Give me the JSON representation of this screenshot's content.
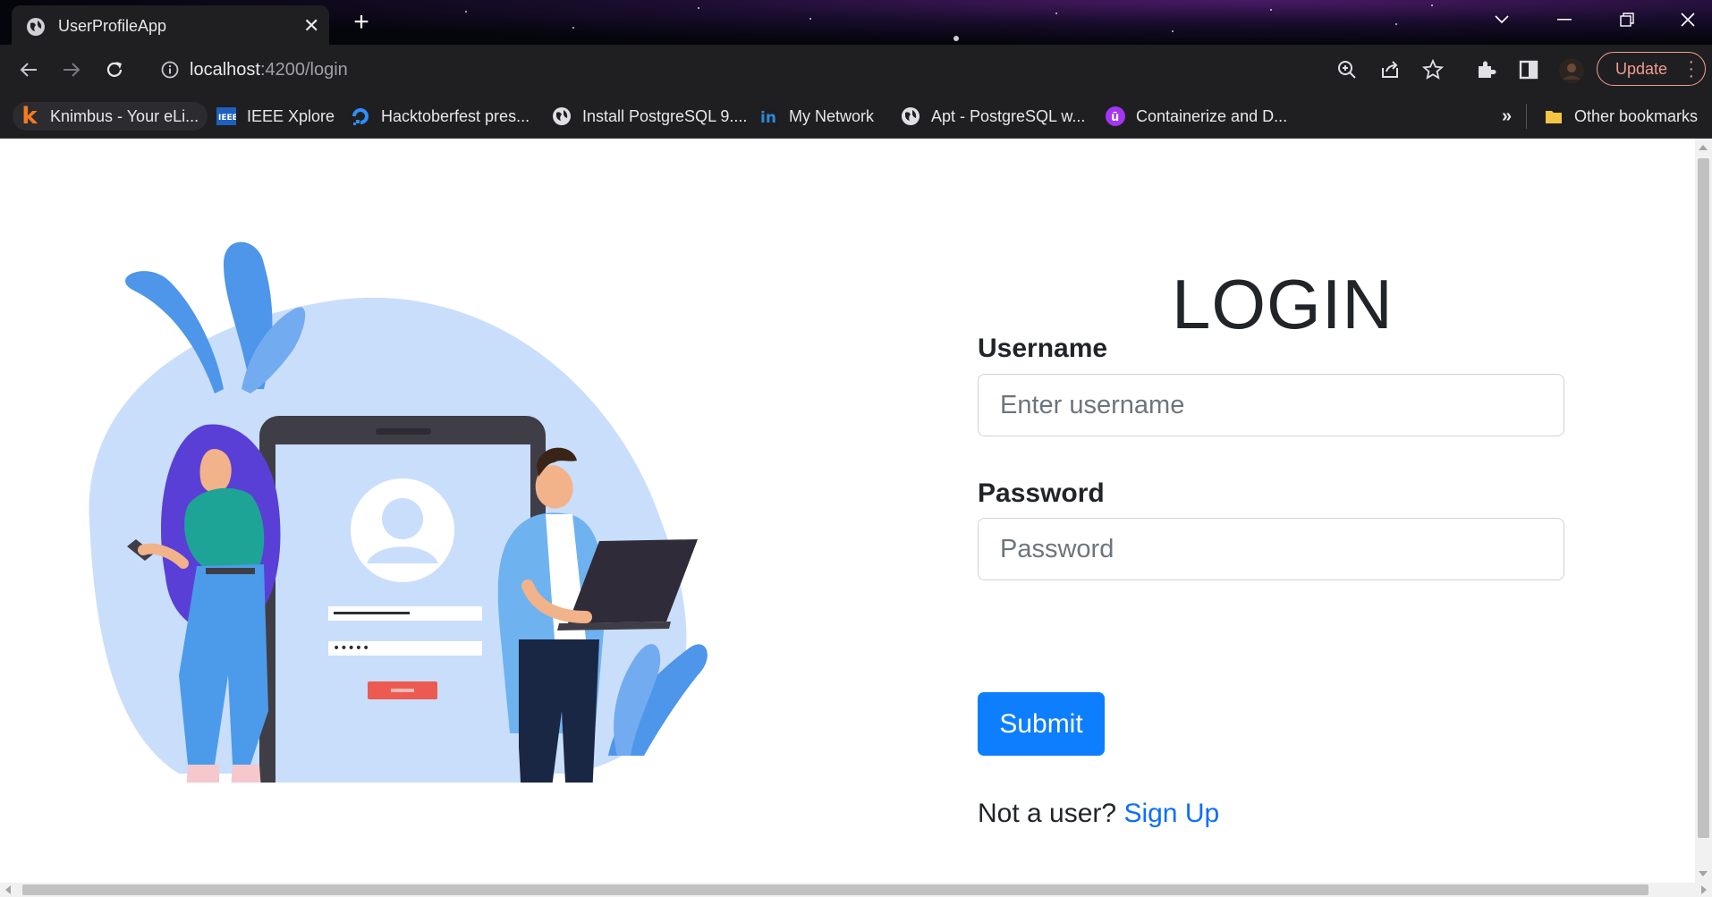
{
  "browser": {
    "tab": {
      "title": "UserProfileApp",
      "close_glyph": "✕"
    },
    "new_tab_glyph": "+",
    "address": {
      "host": "localhost",
      "rest": ":4200/login"
    },
    "update_label": "Update",
    "bookmarks": [
      {
        "label": "Knimbus - Your eLi...",
        "icon": "knimbus-icon"
      },
      {
        "label": "IEEE Xplore",
        "icon": "ieee-icon"
      },
      {
        "label": "Hacktoberfest pres...",
        "icon": "digitalocean-icon"
      },
      {
        "label": "Install PostgreSQL 9....",
        "icon": "globe-icon"
      },
      {
        "label": "My Network",
        "icon": "linkedin-icon"
      },
      {
        "label": "Apt - PostgreSQL w...",
        "icon": "globe-icon"
      },
      {
        "label": "Containerize and D...",
        "icon": "udemy-icon"
      }
    ],
    "overflow_glyph": "»",
    "other_bookmarks": "Other bookmarks"
  },
  "login": {
    "title": "LOGIN",
    "username_label": "Username",
    "username_placeholder": "Enter username",
    "password_label": "Password",
    "password_placeholder": "Password",
    "submit_label": "Submit",
    "signup_prompt": "Not a user?",
    "signup_link": "Sign Up"
  },
  "colors": {
    "primary": "#0d6efd",
    "illustration_blob": "#c9defb",
    "update_accent": "#f29c8f"
  }
}
